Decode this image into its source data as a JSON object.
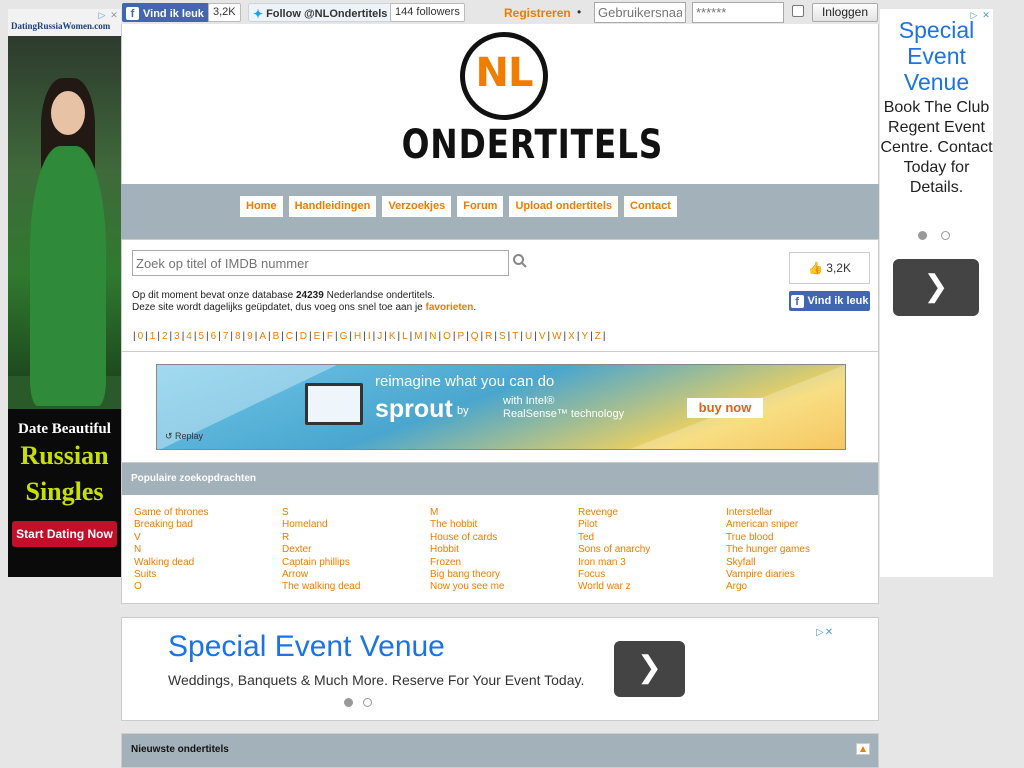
{
  "topbar": {
    "fb_label": "Vind ik leuk",
    "fb_count": "3,2K",
    "twitter_label": "Follow @NLOndertitels",
    "twitter_followers": "144 followers",
    "register": "Registreren",
    "bullet": "•",
    "username_placeholder": "Gebruikersnaam",
    "password_placeholder": "******",
    "login": "Inloggen"
  },
  "left_ad": {
    "logo": "DatingRussiaWomen.com",
    "line1": "Date Beautiful",
    "line2": "Russian",
    "line3": "Singles",
    "cta": "Start Dating Now"
  },
  "right_ad": {
    "title": "Special Event Venue",
    "body": "Book The Club Regent Event Centre. Contact Today for Details."
  },
  "logo": {
    "mark": "NL",
    "word": "ONDERTITELS"
  },
  "nav": {
    "items": [
      {
        "label": "Home"
      },
      {
        "label": "Handleidingen"
      },
      {
        "label": "Verzoekjes"
      },
      {
        "label": "Forum"
      },
      {
        "label": "Upload ondertitels"
      },
      {
        "label": "Contact"
      }
    ]
  },
  "search": {
    "placeholder": "Zoek op titel of IMDB nummer",
    "info_prefix": "Op dit moment bevat onze database",
    "info_count": "24239",
    "info_suffix": "Nederlandse ondertitels.",
    "info2_prefix": "Deze site wordt dagelijks geüpdatet, dus voeg ons snel toe aan je",
    "info2_link": "favorieten",
    "info2_end": ".",
    "like_count": "3,2K",
    "fb_like": "Vind ik leuk"
  },
  "alphabet": [
    "0",
    "1",
    "2",
    "3",
    "4",
    "5",
    "6",
    "7",
    "8",
    "9",
    "A",
    "B",
    "C",
    "D",
    "E",
    "F",
    "G",
    "H",
    "I",
    "J",
    "K",
    "L",
    "M",
    "N",
    "O",
    "P",
    "Q",
    "R",
    "S",
    "T",
    "U",
    "V",
    "W",
    "X",
    "Y",
    "Z"
  ],
  "banner": {
    "headline": "reimagine what you can do",
    "brand": "sprout",
    "by": "by",
    "intel_line1": "with Intel®",
    "intel_line2": "RealSense™ technology",
    "cta": "buy now",
    "replay": "Replay"
  },
  "popular": {
    "title": "Populaire zoekopdrachten",
    "columns": [
      [
        "Game of thrones",
        "Breaking bad",
        "V",
        "N",
        "Walking dead",
        "Suits",
        "O"
      ],
      [
        "S",
        "Homeland",
        "R",
        "Dexter",
        "Captain phillips",
        "Arrow",
        "The walking dead"
      ],
      [
        "M",
        "The hobbit",
        "House of cards",
        "Hobbit",
        "Frozen",
        "Big bang theory",
        "Now you see me"
      ],
      [
        "Revenge",
        "Pilot",
        "Ted",
        "Sons of anarchy",
        "Iron man 3",
        "Focus",
        "World war z"
      ],
      [
        "Interstellar",
        "American sniper",
        "True blood",
        "The hunger games",
        "Skyfall",
        "Vampire diaries",
        "Argo"
      ]
    ]
  },
  "ad2": {
    "title": "Special Event Venue",
    "subtitle": "Weddings, Banquets & Much More. Reserve For Your Event Today."
  },
  "newest": {
    "title": "Nieuwste ondertitels"
  },
  "colors": {
    "accent": "#f07c00",
    "nav_bar": "#a3b2ba",
    "facebook": "#4267b2",
    "ad_blue": "#1a73e8"
  }
}
